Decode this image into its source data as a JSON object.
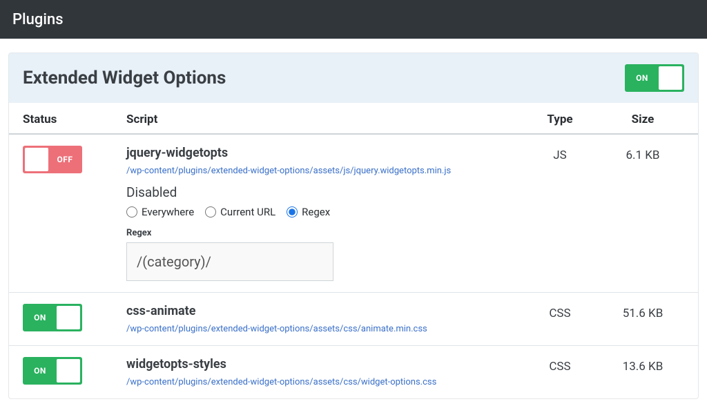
{
  "topbar": {
    "title": "Plugins"
  },
  "panel": {
    "title": "Extended Widget Options",
    "toggle_state": "on",
    "toggle_label": "ON"
  },
  "columns": {
    "status": "Status",
    "script": "Script",
    "type": "Type",
    "size": "Size"
  },
  "rows": [
    {
      "toggle_state": "off",
      "toggle_label": "OFF",
      "name": "jquery-widgetopts",
      "path": "/wp-content/plugins/extended-widget-options/assets/js/jquery.widgetopts.min.js",
      "type": "JS",
      "size": "6.1 KB",
      "disabled": {
        "title": "Disabled",
        "options": [
          "Everywhere",
          "Current URL",
          "Regex"
        ],
        "selected": "Regex",
        "regex_label": "Regex",
        "regex_value": "/(category)/"
      }
    },
    {
      "toggle_state": "on",
      "toggle_label": "ON",
      "name": "css-animate",
      "path": "/wp-content/plugins/extended-widget-options/assets/css/animate.min.css",
      "type": "CSS",
      "size": "51.6 KB"
    },
    {
      "toggle_state": "on",
      "toggle_label": "ON",
      "name": "widgetopts-styles",
      "path": "/wp-content/plugins/extended-widget-options/assets/css/widget-options.css",
      "type": "CSS",
      "size": "13.6 KB"
    }
  ]
}
